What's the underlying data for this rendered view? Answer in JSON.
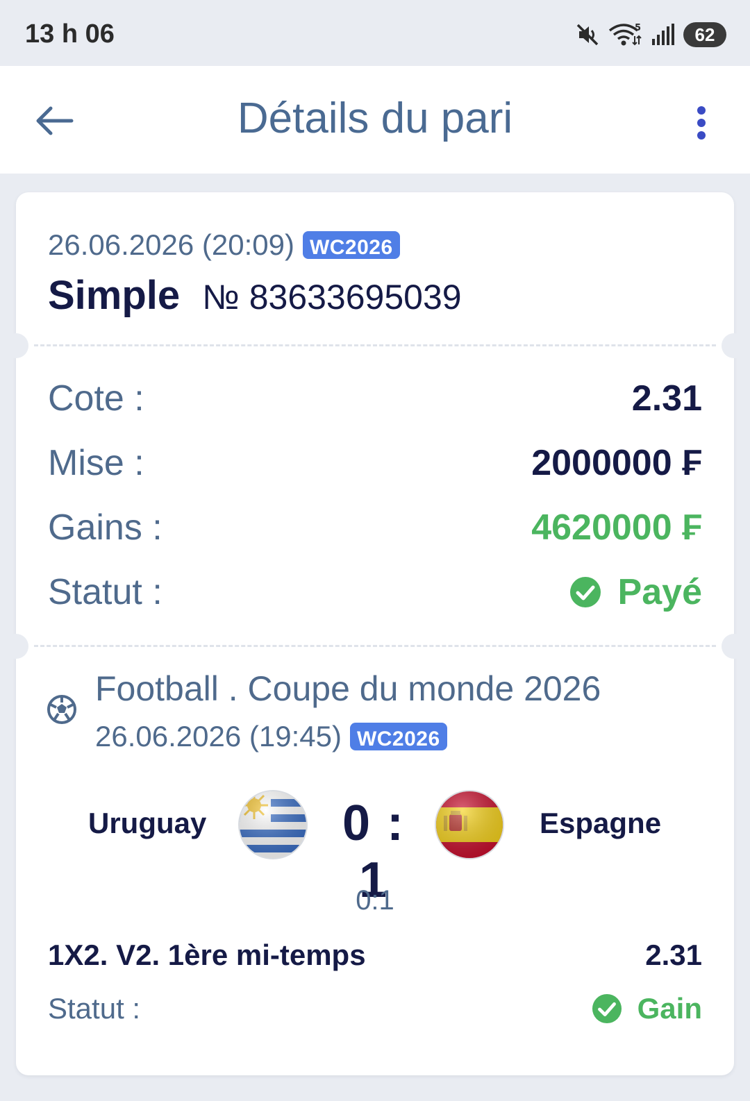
{
  "status_bar": {
    "time": "13 h 06",
    "battery": "62",
    "wifi_badge": "5",
    "icons": [
      "mute-icon",
      "wifi-icon",
      "signal-icon",
      "battery-icon"
    ]
  },
  "header": {
    "title": "Détails du pari",
    "back_icon": "arrow-left-icon",
    "menu_icon": "more-vertical-icon"
  },
  "bet": {
    "date": "26.06.2026 (20:09)",
    "badge": "WC2026",
    "type": "Simple",
    "number": "№ 83633695039"
  },
  "details": {
    "odds_label": "Cote :",
    "odds_value": "2.31",
    "stake_label": "Mise :",
    "stake_value": "2000000 ₣",
    "winnings_label": "Gains :",
    "winnings_value": "4620000 ₣",
    "status_label": "Statut :",
    "status_value": "Payé"
  },
  "event": {
    "sport_icon": "football-icon",
    "title": "Football . Coupe du monde 2026",
    "date": "26.06.2026 (19:45)",
    "badge": "WC2026",
    "home_team": "Uruguay",
    "away_team": "Espagne",
    "score": "0 : 1",
    "half_time_score": "0:1",
    "market": "1X2. V2. 1ère mi-temps",
    "market_odds": "2.31",
    "status_label": "Statut :",
    "status_value": "Gain"
  },
  "colors": {
    "accent_blue": "#4f7ee6",
    "label_blue": "#4f6a8c",
    "dark_text": "#151a46",
    "success_green": "#4bb55f",
    "background": "#e9ecf2"
  }
}
